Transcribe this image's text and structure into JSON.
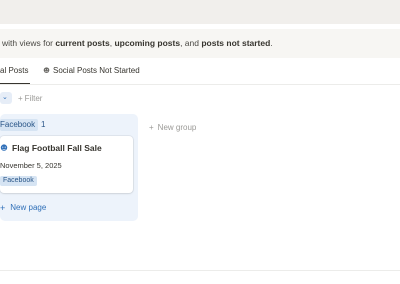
{
  "callout": {
    "lead": " with views for ",
    "bold1": "current posts",
    "sep1": ", ",
    "bold2": "upcoming posts",
    "sep2": ", and ",
    "bold3": "posts not started",
    "tail": "."
  },
  "tabs": [
    {
      "label": "al Posts",
      "icon": ""
    },
    {
      "label": "Social Posts Not Started",
      "icon": "chat-bubble-icon"
    }
  ],
  "toolbar": {
    "view_chevron": "⌄",
    "filter_label": "Filter",
    "filter_plus": "+"
  },
  "board": {
    "group": {
      "label": "Facebook",
      "count": "1"
    },
    "new_group_label": "New group",
    "new_group_plus": "+",
    "card": {
      "title": "Flag Football Fall Sale",
      "date": "November 5, 2025",
      "tag": "Facebook"
    },
    "new_page_label": "New page",
    "new_page_plus": "+"
  },
  "colors": {
    "accent": "#2f6fb8",
    "tag_bg": "#d6e4f3",
    "column_bg": "#edf3fb"
  }
}
